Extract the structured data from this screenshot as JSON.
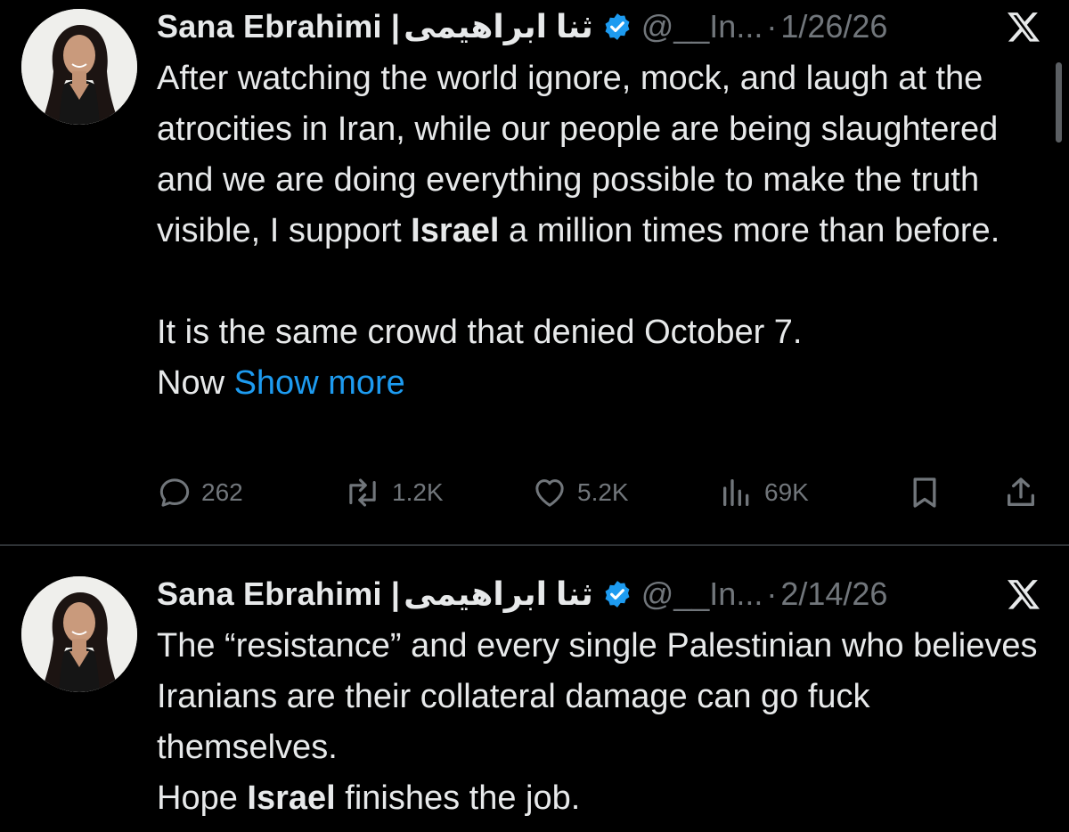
{
  "tweets": [
    {
      "author": {
        "name": "Sana Ebrahimi |",
        "name_fa": "ثنا ابراهیمی",
        "handle": "@__In...",
        "verified": true
      },
      "separator": "·",
      "date": "1/26/26",
      "body": {
        "p1_a": "After watching the world ignore, mock, and laugh at the atrocities in Iran, while our people are being slaughtered and we are doing everything possible to make the truth visible, I support ",
        "p1_bold": "Israel",
        "p1_b": " a million times more than before.",
        "p2": "It is the same crowd that denied October 7.",
        "p3": "Now ",
        "show_more": "Show more"
      },
      "actions": {
        "replies": "262",
        "reposts": "1.2K",
        "likes": "5.2K",
        "views": "69K"
      }
    },
    {
      "author": {
        "name": "Sana Ebrahimi |",
        "name_fa": "ثنا ابراهیمی",
        "handle": "@__In...",
        "verified": true
      },
      "separator": "·",
      "date": "2/14/26",
      "body": {
        "p1": "The “resistance” and every single Palestinian who believes Iranians are their collateral damage can go fuck themselves.",
        "p2_a": "Hope ",
        "p2_bold": "Israel",
        "p2_b": " finishes the job."
      }
    }
  ],
  "colors": {
    "background": "#000000",
    "text": "#e7e9ea",
    "muted": "#71767b",
    "link": "#1d9bf0",
    "verified_badge": "#1d9bf0",
    "divider": "#2f3336"
  },
  "icons": {
    "reply": "reply-icon",
    "repost": "repost-icon",
    "like": "like-icon",
    "views": "views-icon",
    "bookmark": "bookmark-icon",
    "share": "share-icon",
    "verified": "verified-badge-icon",
    "x_logo": "x-logo-icon"
  }
}
